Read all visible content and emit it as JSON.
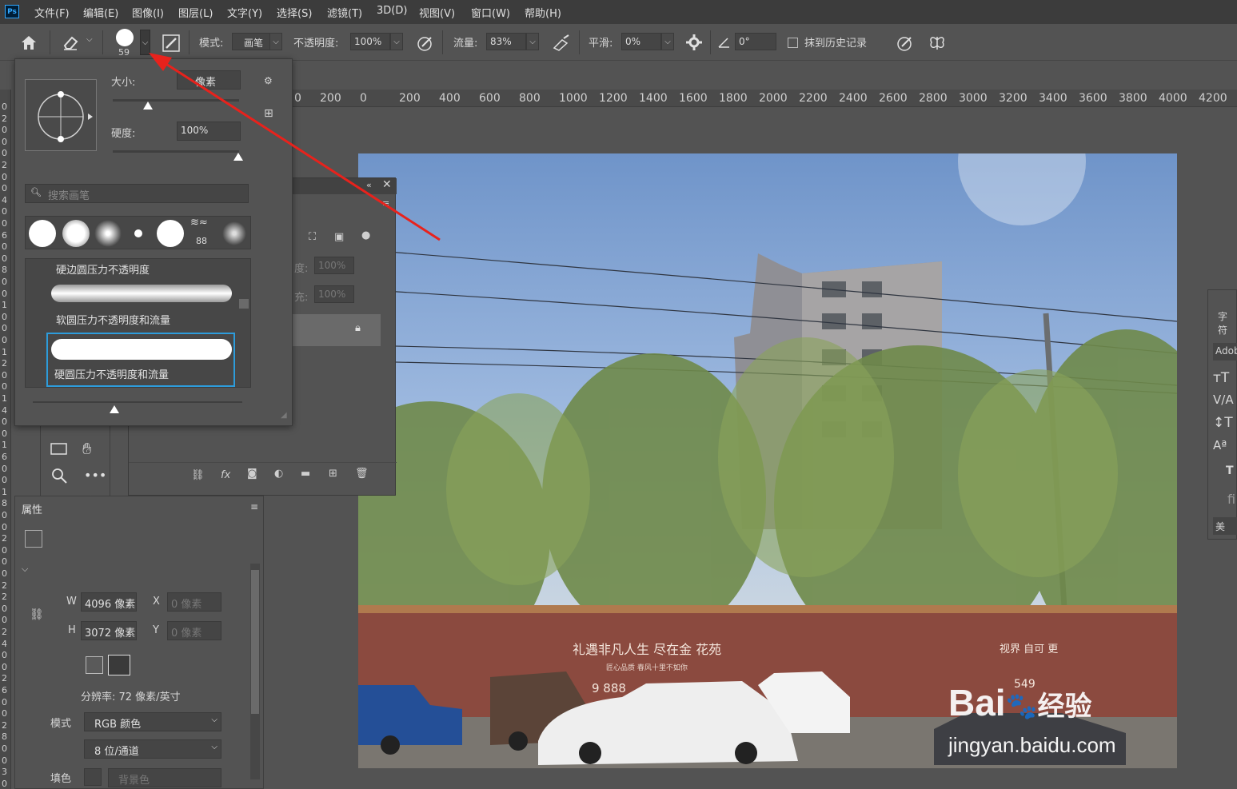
{
  "app": {
    "logo": "Ps"
  },
  "menu": [
    "文件(F)",
    "编辑(E)",
    "图像(I)",
    "图层(L)",
    "文字(Y)",
    "选择(S)",
    "滤镜(T)",
    "3D(D)",
    "视图(V)",
    "窗口(W)",
    "帮助(H)"
  ],
  "options_bar": {
    "brush_size": "59",
    "mode_label": "模式:",
    "mode_value": "画笔",
    "opacity_label": "不透明度:",
    "opacity_value": "100%",
    "flow_label": "流量:",
    "flow_value": "83%",
    "smoothing_label": "平滑:",
    "smoothing_value": "0%",
    "angle_value": "0°",
    "erase_history_label": "抹到历史记录"
  },
  "brush_popup": {
    "size_label": "大小:",
    "size_value": "像素",
    "hardness_label": "硬度:",
    "hardness_value": "100%",
    "search_placeholder": "搜索画笔",
    "preset_count": "88",
    "brushes": [
      {
        "name": "硬边圆压力不透明度"
      },
      {
        "name": "软圆压力不透明度和流量"
      },
      {
        "name": "硬圆压力不透明度和流量"
      }
    ]
  },
  "layers_panel": {
    "opacity_label": "度:",
    "opacity_value": "100%",
    "fill_label": "充:",
    "fill_value": "100%"
  },
  "properties": {
    "title": "属性",
    "w_label": "W",
    "w_value": "4096 像素",
    "h_label": "H",
    "h_value": "3072 像素",
    "x_label": "X",
    "x_value": "0 像素",
    "y_label": "Y",
    "y_value": "0 像素",
    "resolution": "分辨率: 72 像素/英寸",
    "mode_label": "模式",
    "mode_value": "RGB 颜色",
    "depth_value": "8 位/通道",
    "fill_label": "填色",
    "fill_value": "背景色"
  },
  "ruler_ticks": [
    "0",
    "200",
    "0",
    "200",
    "400",
    "600",
    "800",
    "1000",
    "1200",
    "1400",
    "1600",
    "1800",
    "2000",
    "2200",
    "2400",
    "2600",
    "2800",
    "3000",
    "3200",
    "3400",
    "3600",
    "3800",
    "4000",
    "4200"
  ],
  "char_panel": {
    "title": "字符",
    "font": "Adob",
    "style_partial": "美"
  },
  "watermark": {
    "logo_text": "Bai",
    "logo_text_2": "经验",
    "url": "jingyan.baidu.com"
  },
  "photo_text": {
    "banner": "礼遇非凡人生 尽在金 花苑",
    "sub": "匠心品质 春风十里不如你",
    "phone": "9 888",
    "banner2": "视界 自可 更",
    "phone2": "549"
  },
  "colors": {
    "foreground": "#f2f2f2",
    "background": "#e6121f",
    "annotation_arrow": "#e8221c",
    "accent": "#31a8ff"
  }
}
